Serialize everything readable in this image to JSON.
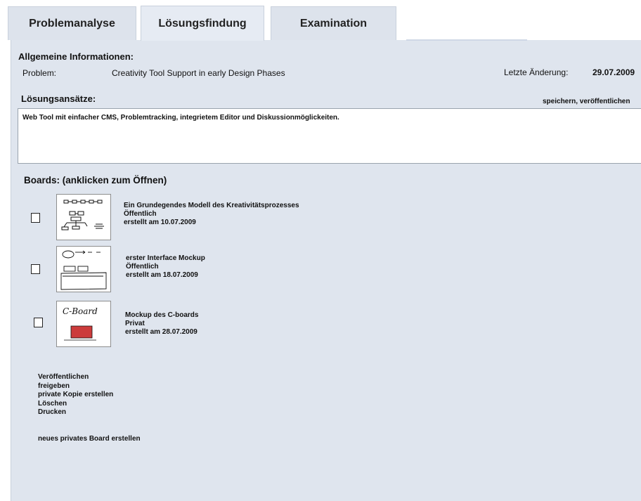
{
  "tabs": [
    {
      "label": "Problemanalyse"
    },
    {
      "label": "Lösungsfindung"
    },
    {
      "label": "Examination"
    }
  ],
  "info": {
    "heading": "Allgemeine Informationen:",
    "problem_label": "Problem:",
    "problem_value": "Creativity Tool Support in early Design Phases",
    "changed_label": "Letzte Änderung:",
    "changed_value": "29.07.2009"
  },
  "solutions": {
    "heading": "Lösungsansätze:",
    "actions": "speichern, veröffentlichen",
    "text": "Web Tool mit einfacher CMS, Problemtracking, integrietem Editor und Diskussionmöglickeiten."
  },
  "boards": {
    "heading": "Boards: (anklicken zum Öffnen)",
    "items": [
      {
        "title": "Ein Grundegendes Modell des Kreativitätsprozesses",
        "visibility": "Öffentlich",
        "created": "erstellt am 10.07.2009",
        "thumb_icon": "flowchart-sketch-icon"
      },
      {
        "title": "erster Interface Mockup",
        "visibility": "Öffentlich",
        "created": "erstellt am 18.07.2009",
        "thumb_icon": "interface-sketch-icon"
      },
      {
        "title": "Mockup des C-boards",
        "visibility": "Privat",
        "created": "erstellt am 28.07.2009",
        "thumb_icon": "c-board-sketch-icon",
        "thumb_text": "C-Board",
        "thumb_color": "#cc3b3b"
      }
    ]
  },
  "menu": {
    "items": [
      "Veröffentlichen",
      "freigeben",
      "private Kopie erstellen",
      "Löschen",
      "Drucken"
    ],
    "new_board": "neues privates Board erstellen"
  }
}
